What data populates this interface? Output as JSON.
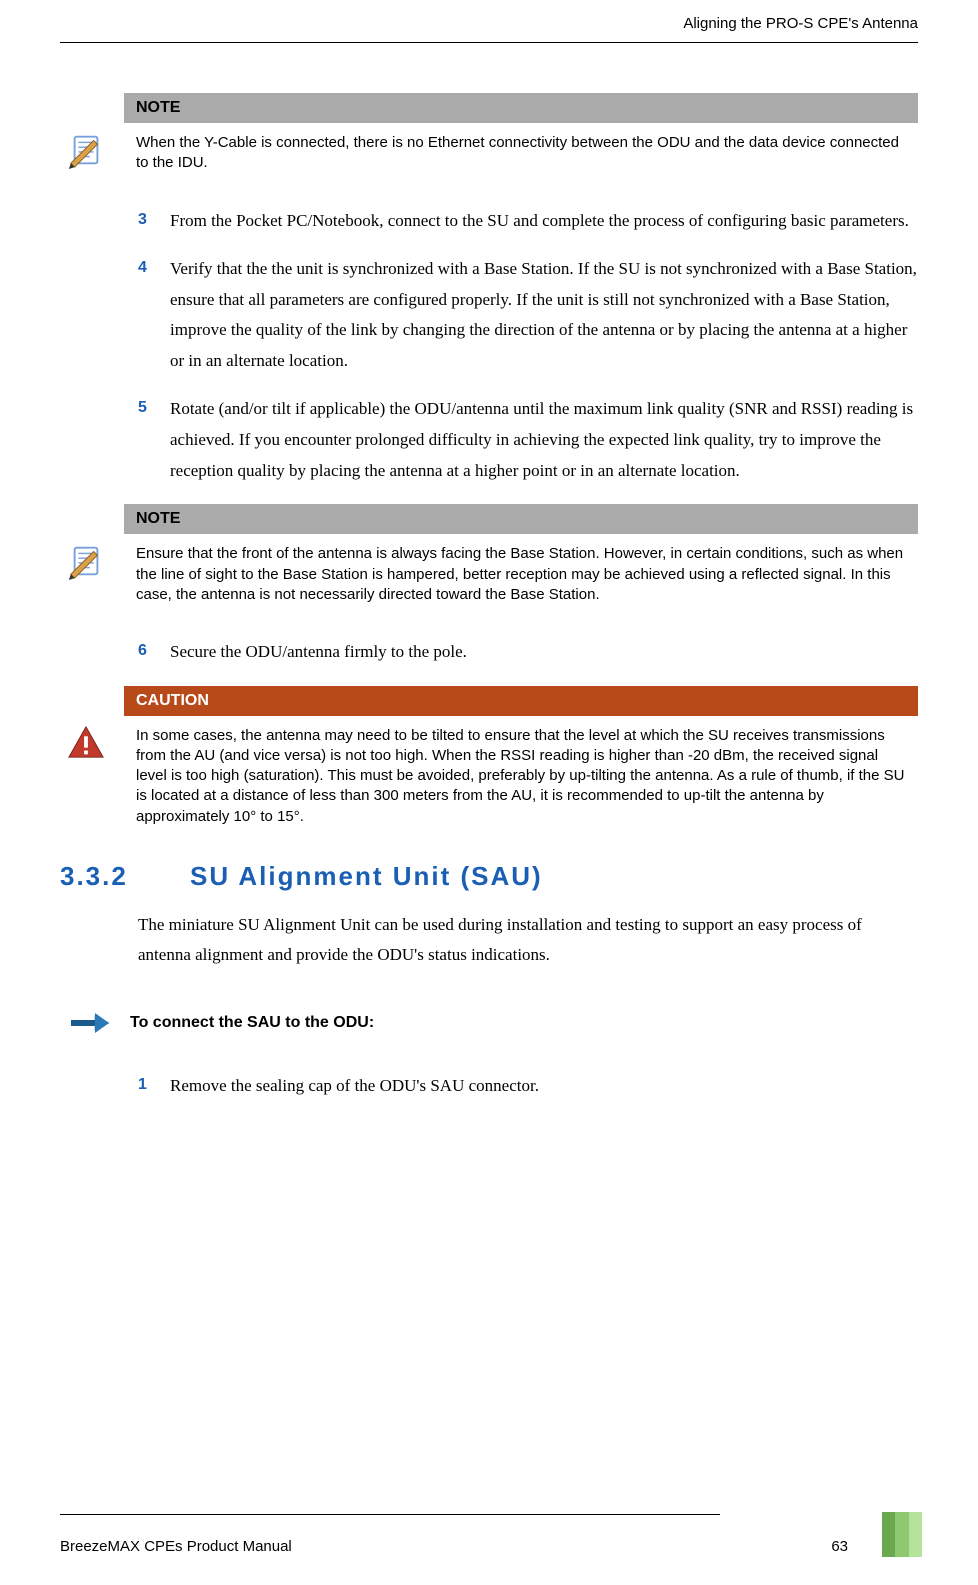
{
  "header": {
    "running_title": "Aligning the PRO-S CPE's Antenna"
  },
  "note1": {
    "label": "NOTE",
    "text": "When the Y-Cable is connected, there is no Ethernet connectivity between the ODU and the data device connected to the IDU."
  },
  "steps_a": [
    {
      "num": "3",
      "text": "From the Pocket PC/Notebook, connect to the SU and complete the process of configuring basic parameters."
    },
    {
      "num": "4",
      "text": "Verify that the the unit is synchronized with a Base Station. If the SU is not synchronized with a Base Station, ensure that all parameters are configured properly. If the unit is still not synchronized with a Base Station, improve the quality of the link by changing the direction of the antenna or by placing the antenna at a higher or in an alternate location."
    },
    {
      "num": "5",
      "text": "Rotate (and/or tilt if applicable) the ODU/antenna until the maximum link quality (SNR and RSSI) reading is achieved. If you encounter prolonged difficulty in achieving the expected link quality, try to improve the reception quality by placing the antenna at a higher point or in an alternate location."
    }
  ],
  "note2": {
    "label": "NOTE",
    "text": "Ensure that the front of the antenna is always facing the Base Station. However, in certain conditions, such as when the line of sight to the Base Station is hampered, better reception may be achieved using a reflected signal. In this case, the antenna is not necessarily directed toward the Base Station."
  },
  "steps_b": [
    {
      "num": "6",
      "text": "Secure the ODU/antenna firmly to the pole."
    }
  ],
  "caution": {
    "label": "CAUTION",
    "text": "In some cases, the antenna may need to be tilted to ensure that the level at which the SU receives transmissions from the AU (and vice versa) is not too high. When the RSSI reading is higher than -20 dBm, the received signal level is too high (saturation). This must be avoided, preferably by up-tilting the antenna. As a rule of thumb, if the SU is located at a distance of less than 300 meters from the AU, it is recommended to up-tilt the antenna by approximately 10° to 15°."
  },
  "section": {
    "number": "3.3.2",
    "title": "SU Alignment Unit (SAU)"
  },
  "section_para": "The miniature SU Alignment Unit can be used during installation and testing to support an easy process of antenna alignment and provide the ODU's status indications.",
  "procedure": {
    "title": "To connect the SAU to the ODU:"
  },
  "steps_c": [
    {
      "num": "1",
      "text": "Remove the sealing cap of the ODU's SAU connector."
    }
  ],
  "footer": {
    "book_title": "BreezeMAX CPEs Product Manual",
    "page_num": "63"
  }
}
